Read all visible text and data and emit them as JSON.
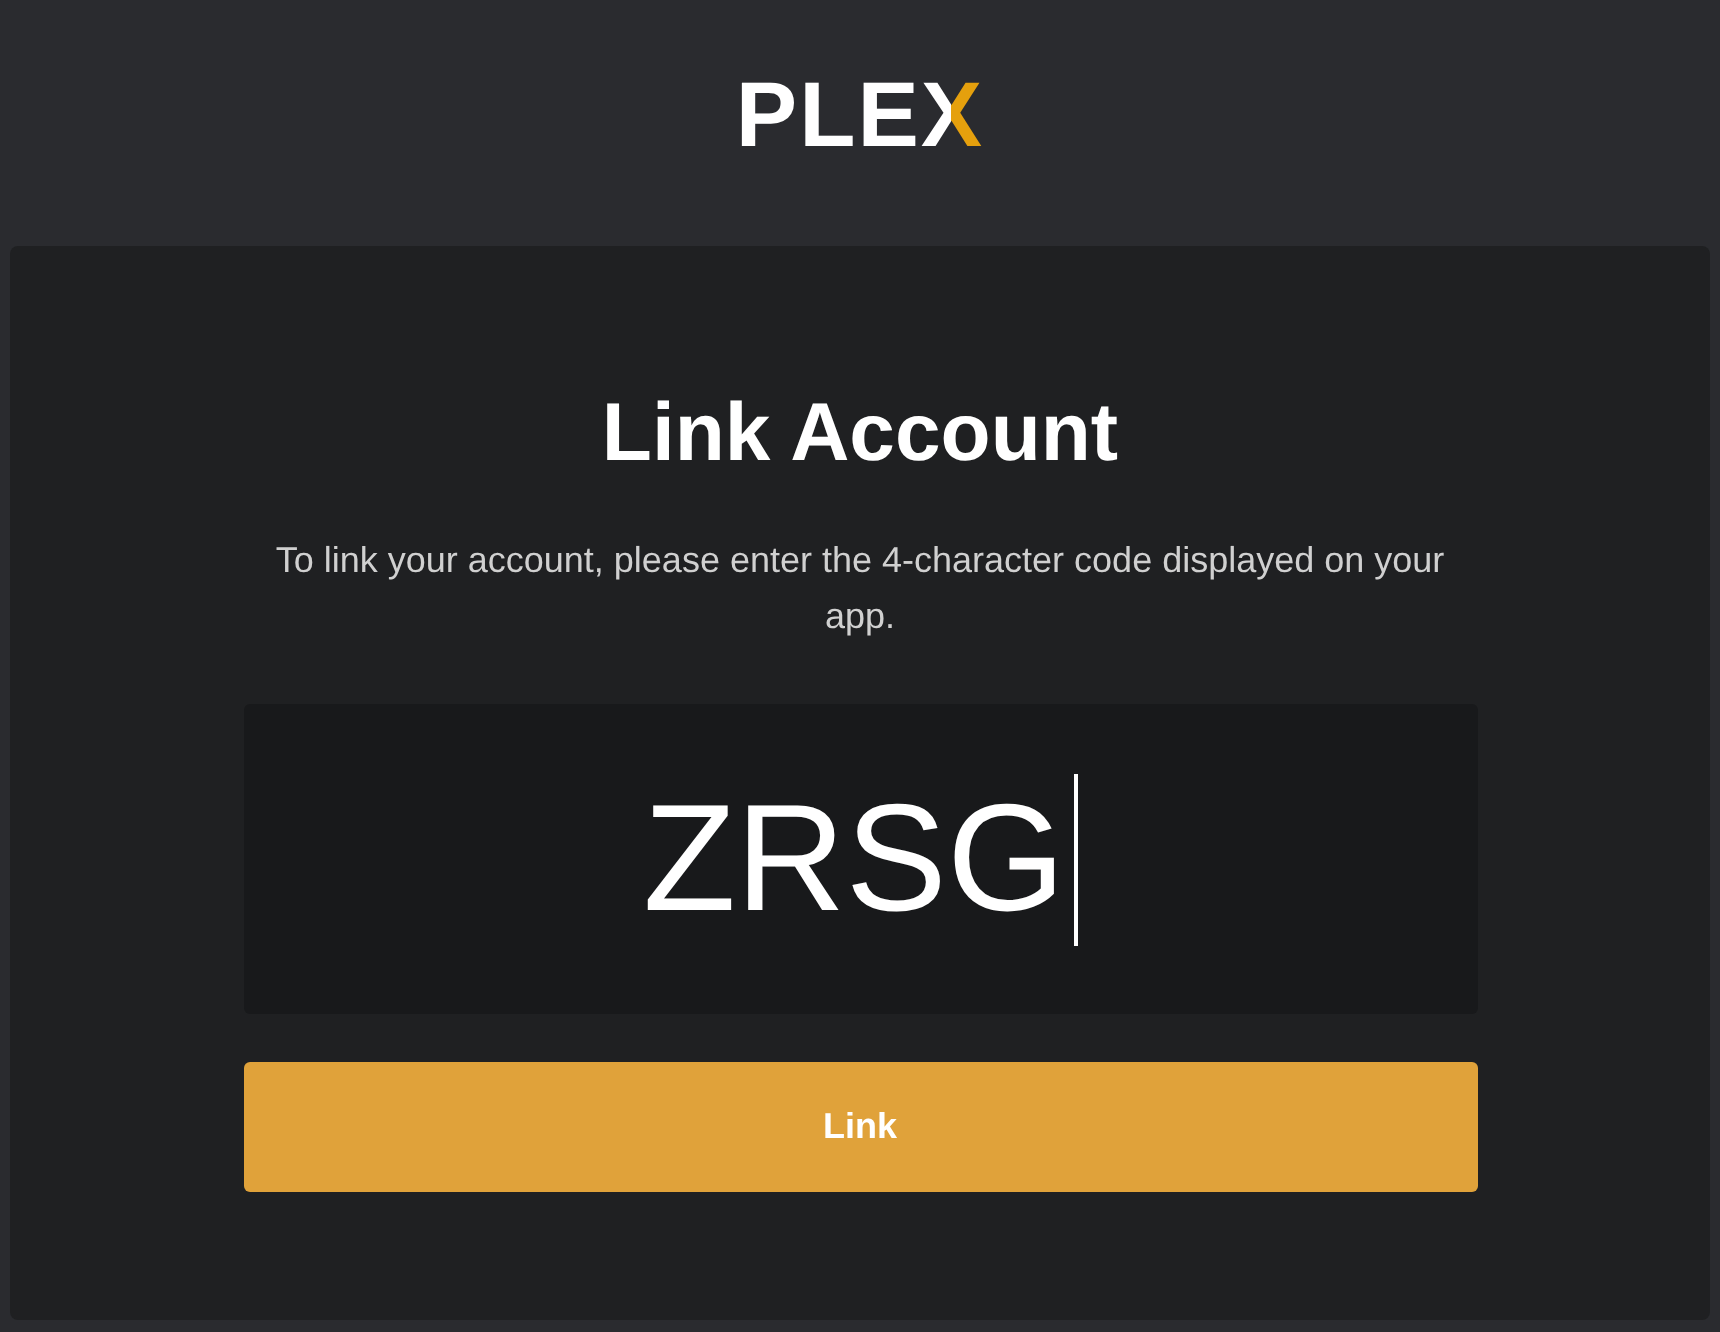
{
  "logo": {
    "text": "PLE",
    "accent": "X"
  },
  "card": {
    "title": "Link Account",
    "description": "To link your account, please enter the 4-character code displayed on your app."
  },
  "code_field": {
    "value": "ZRSG",
    "focused": true
  },
  "button": {
    "label": "Link"
  }
}
